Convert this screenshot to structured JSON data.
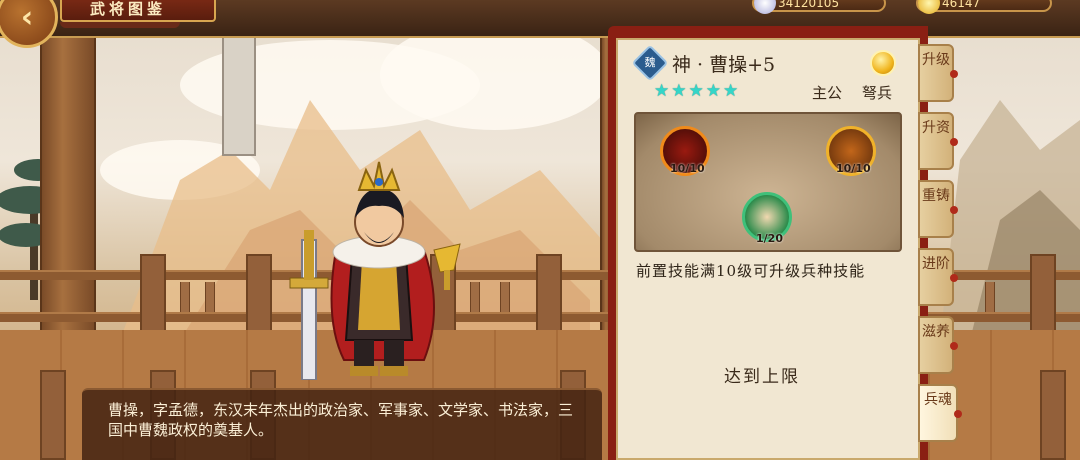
{
  "header": {
    "back_icon": "left-arrow-icon",
    "title": "武将图鉴",
    "resources": [
      {
        "icon": "silver-coin-icon",
        "value": "34120105",
        "color": "#c8c8ff"
      },
      {
        "icon": "gold-ingot-icon",
        "value": "46147",
        "color": "#f3c13a"
      }
    ]
  },
  "hero": {
    "faction_badge": "魏",
    "name": "神 · 曹操+5",
    "star_count": 5,
    "star_glyph": "★",
    "role": "主公",
    "unit_type": "弩兵",
    "action_icon": "gold-coin-icon"
  },
  "skills": [
    {
      "icon": "red-beast-skill-icon",
      "count": "10/10"
    },
    {
      "icon": "flame-banner-skill-icon",
      "count": "10/10"
    },
    {
      "icon": "green-dragon-soldier-skill-icon",
      "count": "1/20"
    }
  ],
  "skill_panel": {
    "requirement": "前置技能满10级可升级兵种技能",
    "max_label": "达到上限"
  },
  "tabs": [
    {
      "label": "升级",
      "active": false
    },
    {
      "label": "升资",
      "active": false
    },
    {
      "label": "重铸",
      "active": false
    },
    {
      "label": "进阶",
      "active": false
    },
    {
      "label": "滋养",
      "active": false
    },
    {
      "label": "兵魂",
      "active": true
    }
  ],
  "description": "曹操，字孟德，东汉末年杰出的政治家、军事家、文学家、书法家，三国中曹魏政权的奠基人。"
}
